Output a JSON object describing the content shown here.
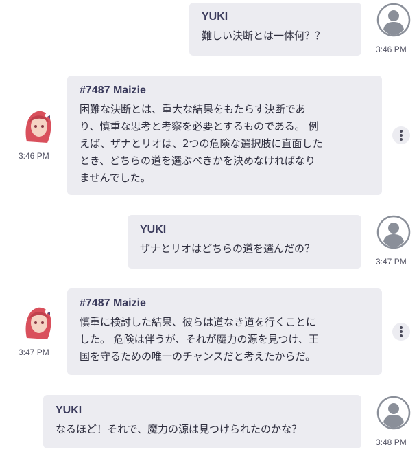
{
  "messages": [
    {
      "sender": "YUKI",
      "role": "user",
      "lines": [
        "難しい決断とは一体何？？"
      ],
      "time": "3:46 PM"
    },
    {
      "sender": "#7487 Maizie",
      "role": "bot",
      "lines": [
        "困難な決断とは、重大な結果をもたらす決断であ",
        "り、慎重な思考と考察を必要とするものである。 例",
        "えば、ザナとリオは、2つの危険な選択肢に直面した",
        "とき、どちらの道を選ぶべきかを決めなければなり",
        "ませんでした。"
      ],
      "time": "3:46 PM"
    },
    {
      "sender": "YUKI",
      "role": "user",
      "lines": [
        "ザナとリオはどちらの道を選んだの？"
      ],
      "time": "3:47 PM"
    },
    {
      "sender": "#7487 Maizie",
      "role": "bot",
      "lines": [
        "慎重に検討した結果、彼らは道なき道を行くことに",
        "した。 危険は伴うが、それが魔力の源を見つけ、王",
        "国を守るための唯一のチャンスだと考えたからだ。"
      ],
      "time": "3:47 PM"
    },
    {
      "sender": "YUKI",
      "role": "user",
      "lines": [
        "なるほど！それで、魔力の源は見つけられたのかな？"
      ],
      "time": "3:48 PM"
    }
  ],
  "colors": {
    "bubble": "#ececf1",
    "name": "#3b3b5c",
    "avatar_gray": "#8a8f99",
    "bot_hair": "#d9505c"
  },
  "icons": {
    "user_avatar": "user-avatar-icon",
    "bot_avatar": "bot-avatar-icon",
    "more": "more-options-icon"
  }
}
